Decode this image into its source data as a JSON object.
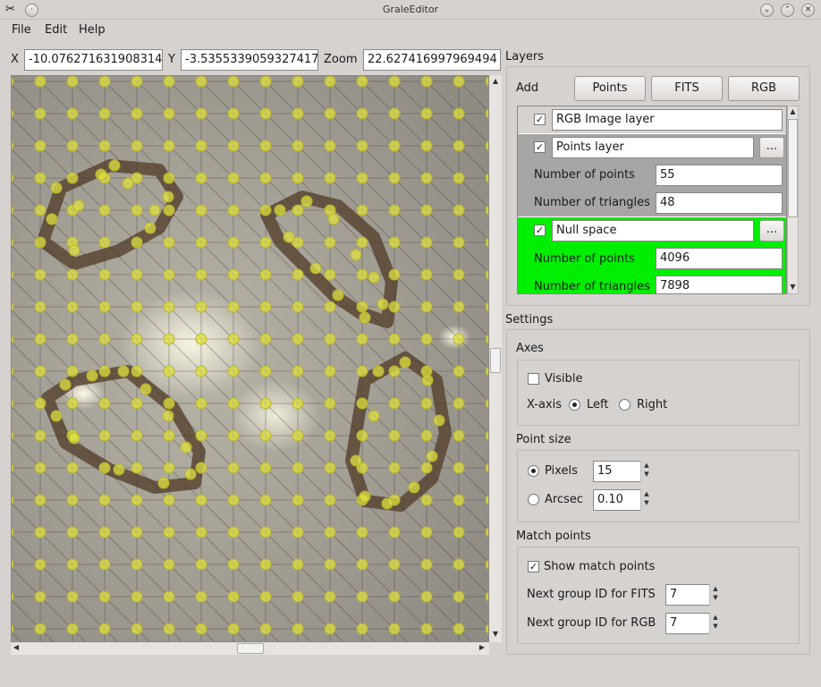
{
  "window": {
    "title": "GraleEditor"
  },
  "menu": [
    "File",
    "Edit",
    "Help"
  ],
  "coords": {
    "x_label": "X",
    "x_value": "-10.076271631908314",
    "y_label": "Y",
    "y_value": "-3.5355339059327417",
    "zoom_label": "Zoom",
    "zoom_value": "22.627416997969494"
  },
  "layers_panel": {
    "title": "Layers",
    "add_label": "Add",
    "buttons": {
      "points": "Points",
      "fits": "FITS",
      "rgb": "RGB"
    },
    "layers": [
      {
        "name": "RGB Image layer",
        "checked": true
      },
      {
        "name": "Points layer",
        "checked": true,
        "more": "...",
        "num_points_label": "Number of points",
        "num_points": "55",
        "num_triangles_label": "Number of triangles",
        "num_triangles": "48"
      },
      {
        "name": "Null space",
        "checked": true,
        "more": "...",
        "num_points_label": "Number of points",
        "num_points": "4096",
        "num_triangles_label": "Number of triangles",
        "num_triangles": "7898"
      }
    ]
  },
  "settings": {
    "title": "Settings",
    "axes": {
      "title": "Axes",
      "visible_label": "Visible",
      "visible": false,
      "xaxis_label": "X-axis",
      "left_label": "Left",
      "right_label": "Right",
      "selected": "Left"
    },
    "point_size": {
      "title": "Point size",
      "pixels_label": "Pixels",
      "pixels_value": "15",
      "arcsec_label": "Arcsec",
      "arcsec_value": "0.10",
      "selected": "Pixels"
    },
    "match_points": {
      "title": "Match points",
      "show_label": "Show match points",
      "show": true,
      "fits_label": "Next group ID for FITS",
      "fits_value": "7",
      "rgb_label": "Next group ID for RGB",
      "rgb_value": "7"
    }
  },
  "colors": {
    "null_space_bg": "#00ee00",
    "points_layer_bg": "#a8a6a4",
    "point_fill": "#e0e040"
  }
}
